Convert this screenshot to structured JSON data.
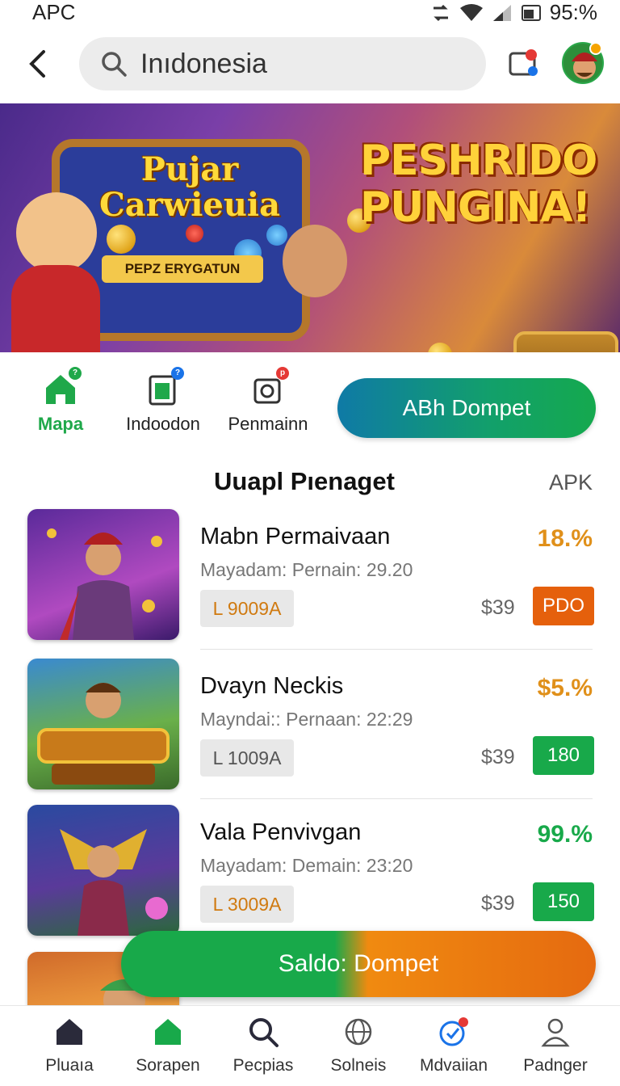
{
  "status_bar": {
    "carrier": "APC",
    "battery": "95:%"
  },
  "header": {
    "search_value": "Inıdonesia"
  },
  "banner": {
    "left_title": "Pujar Carwieuia",
    "left_subtitle": "PEPZ ERYGATUN",
    "right_title": "PESHRIDO PUNGINA!"
  },
  "quick_nav": [
    {
      "label": "Mapa",
      "icon": "home-icon",
      "badge": "?"
    },
    {
      "label": "Indoodon",
      "icon": "wallet-card-icon",
      "badge": "?"
    },
    {
      "label": "Penmainn",
      "icon": "camera-icon",
      "badge": "p"
    }
  ],
  "wallet_button": "ABh Dompet",
  "section": {
    "title": "Uuapl Pıenaget",
    "link": "APK"
  },
  "games": [
    {
      "name": "Mabn Permaivaan",
      "meta": "Mayadam: Pernain: 29.20",
      "code": "L 9009A",
      "percent": "18.%",
      "percent_color": "#e0901a",
      "price": "$39",
      "badge": "PDO",
      "badge_color": "#e5600c",
      "code_color": "#d07a10"
    },
    {
      "name": "Dvayn Neckis",
      "meta": "Mayndai:: Pernaan: 22:29",
      "code": "L 1009A",
      "percent": "$5.%",
      "percent_color": "#e0901a",
      "price": "$39",
      "badge": "180",
      "badge_color": "#18a94a",
      "code_color": "#555555"
    },
    {
      "name": "Vala Penvivgan",
      "meta": "Mayadam: Demain: 23:20",
      "code": "L 3009A",
      "percent": "99.%",
      "percent_color": "#18a94a",
      "price": "$39",
      "badge": "150",
      "badge_color": "#18a94a",
      "code_color": "#d07a10"
    }
  ],
  "saldo_button": "Saldo: Dompet",
  "bottom_nav": [
    {
      "label": "Pluaıa",
      "icon": "home-icon"
    },
    {
      "label": "Sorapen",
      "icon": "home-green-icon"
    },
    {
      "label": "Pecpias",
      "icon": "search-icon"
    },
    {
      "label": "Solneis",
      "icon": "globe-icon"
    },
    {
      "label": "Mdvaiian",
      "icon": "clock-badge-icon"
    },
    {
      "label": "Padnger",
      "icon": "user-icon"
    }
  ],
  "colors": {
    "accent_green": "#18a94a",
    "accent_orange": "#e5600c",
    "teal": "#0f7aa6"
  }
}
